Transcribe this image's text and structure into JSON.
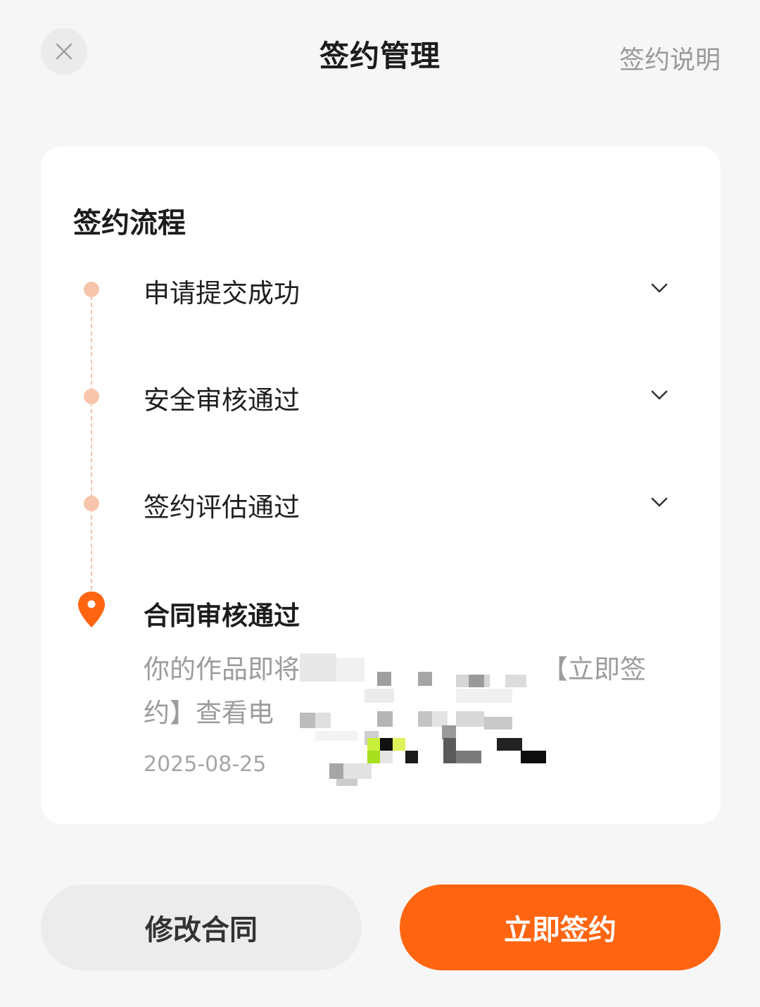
{
  "header": {
    "title": "签约管理",
    "help_link": "签约说明",
    "close_icon": "close-icon"
  },
  "process": {
    "title": "签约流程",
    "steps": [
      {
        "label": "申请提交成功",
        "status": "done",
        "icon": "chevron-down-icon"
      },
      {
        "label": "安全审核通过",
        "status": "done",
        "icon": "chevron-down-icon"
      },
      {
        "label": "签约评估通过",
        "status": "done",
        "icon": "chevron-down-icon"
      }
    ],
    "current": {
      "label": "合同审核通过",
      "icon": "location-pin-icon",
      "desc_line1_start": "你的作品即将",
      "desc_line1_end": "【立即签",
      "desc_line2_start": "约】查看电",
      "date": "2025-08-25"
    }
  },
  "actions": {
    "modify_label": "修改合同",
    "sign_label": "立即签约"
  },
  "colors": {
    "accent": "#ff6511",
    "dot_done": "#f7c5ab",
    "text_muted": "#9c9c9c",
    "background": "#f6f6f6"
  }
}
